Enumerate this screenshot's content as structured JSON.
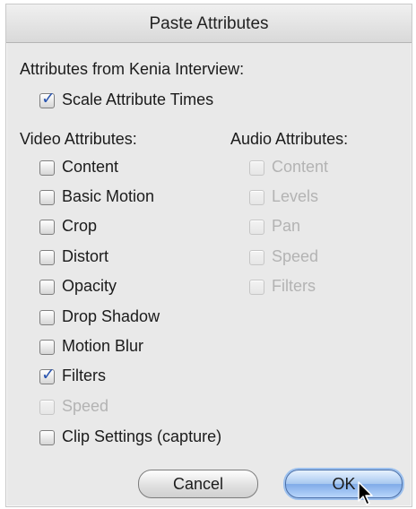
{
  "dialog": {
    "title": "Paste Attributes",
    "attributes_from": "Attributes from Kenia Interview:",
    "scale_attribute_times": {
      "label": "Scale Attribute Times",
      "checked": true,
      "enabled": true
    }
  },
  "video": {
    "heading": "Video Attributes:",
    "items": [
      {
        "label": "Content",
        "checked": false,
        "enabled": true
      },
      {
        "label": "Basic Motion",
        "checked": false,
        "enabled": true
      },
      {
        "label": "Crop",
        "checked": false,
        "enabled": true
      },
      {
        "label": "Distort",
        "checked": false,
        "enabled": true
      },
      {
        "label": "Opacity",
        "checked": false,
        "enabled": true
      },
      {
        "label": "Drop Shadow",
        "checked": false,
        "enabled": true
      },
      {
        "label": "Motion Blur",
        "checked": false,
        "enabled": true
      },
      {
        "label": "Filters",
        "checked": true,
        "enabled": true
      },
      {
        "label": "Speed",
        "checked": false,
        "enabled": false
      },
      {
        "label": "Clip Settings (capture)",
        "checked": false,
        "enabled": true
      }
    ]
  },
  "audio": {
    "heading": "Audio Attributes:",
    "items": [
      {
        "label": "Content",
        "checked": false,
        "enabled": false
      },
      {
        "label": "Levels",
        "checked": false,
        "enabled": false
      },
      {
        "label": "Pan",
        "checked": false,
        "enabled": false
      },
      {
        "label": "Speed",
        "checked": false,
        "enabled": false
      },
      {
        "label": "Filters",
        "checked": false,
        "enabled": false
      }
    ]
  },
  "buttons": {
    "cancel": "Cancel",
    "ok": "OK"
  },
  "icons": {
    "checkmark": "checkmark-icon",
    "cursor": "arrow-cursor-icon"
  }
}
